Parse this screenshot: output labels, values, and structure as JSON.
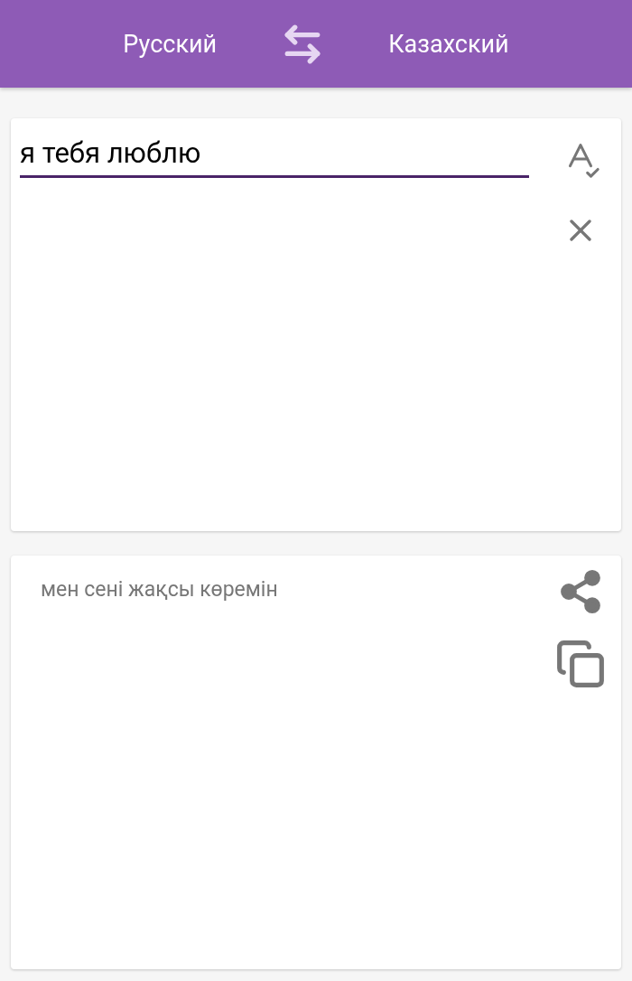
{
  "header": {
    "source_language": "Русский",
    "target_language": "Казахский"
  },
  "input": {
    "value": "я тебя люблю"
  },
  "translation": {
    "text": "мен сені жақсы көремін"
  }
}
